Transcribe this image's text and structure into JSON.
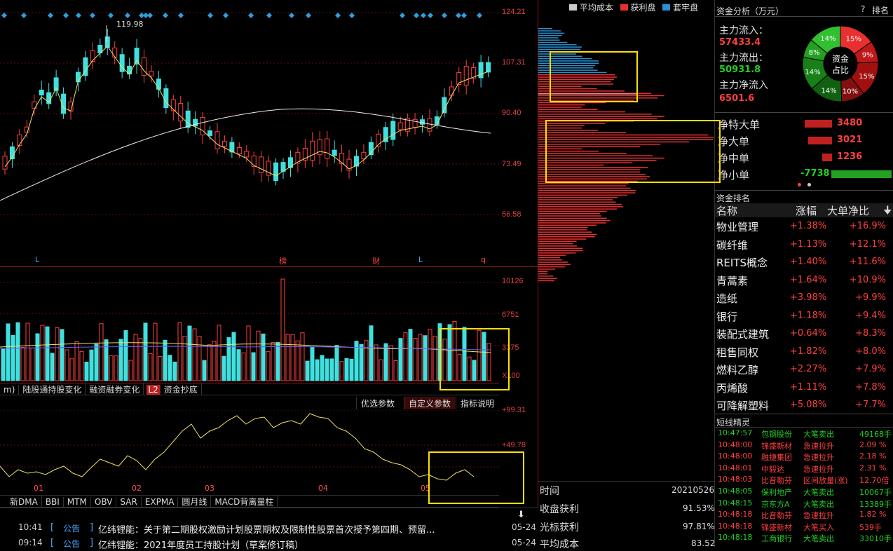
{
  "price_axis": [
    "124.21",
    "107.31",
    "90.40",
    "73.49",
    "56.58"
  ],
  "price_annotation": "119.98",
  "event_markers": [
    "L",
    "榜",
    "财",
    "L",
    "q"
  ],
  "volume_axis": [
    "10126",
    "6751",
    "3375",
    "X100"
  ],
  "indicator_tabs": [
    "m)",
    "陆股通持股变化",
    "融资融券变化",
    "L2",
    "资金抄底"
  ],
  "param_buttons": [
    "优选参数",
    "自定义参数",
    "指标说明"
  ],
  "osc_axis": [
    "+99.31",
    "+49.78"
  ],
  "month_labels": [
    "01",
    "02",
    "03",
    "04",
    "05"
  ],
  "bottom_tabs": [
    "新DMA",
    "BBI",
    "MTM",
    "OBV",
    "SAR",
    "EXPMA",
    "圆月线",
    "MACD背离量柱"
  ],
  "news": [
    {
      "time": "10:41",
      "tag": "公告",
      "text": "亿纬锂能：关于第二期股权激励计划股票期权及限制性股票首次授予第四期、预留...",
      "date": "05-24"
    },
    {
      "time": "09:14",
      "tag": "公告",
      "text": "亿纬锂能：2021年度员工持股计划（草案修订稿）",
      "date": "05-24"
    }
  ],
  "chip_legend": {
    "avg": "平均成本",
    "profit": "获利盘",
    "trapped": "套牢盘"
  },
  "chip_stats": {
    "time_label": "时间",
    "time_value": "20210526",
    "close_profit_label": "收盘获利",
    "close_profit_value": "91.53%",
    "cursor_profit_label": "光标获利",
    "cursor_profit_value": "97.81%",
    "avg_cost_label": "平均成本",
    "avg_cost_value": "83.52"
  },
  "fund": {
    "title": "资金分析（万元）",
    "help": "?",
    "rank_link": "排名",
    "inflow_label": "主力流入：",
    "inflow": "57433.4",
    "outflow_label": "主力流出：",
    "outflow": "50931.8",
    "net_label": "主力净流入",
    "net": "6501.6",
    "donut_center": [
      "资金",
      "占比"
    ],
    "donut": [
      {
        "label": "15%",
        "value": 15,
        "color": "#e83030"
      },
      {
        "label": "9%",
        "value": 9,
        "color": "#c01818"
      },
      {
        "label": "15%",
        "value": 15,
        "color": "#a01010"
      },
      {
        "label": "10%",
        "value": 10,
        "color": "#801010"
      },
      {
        "label": "14%",
        "value": 14,
        "color": "#106010"
      },
      {
        "label": "14%",
        "value": 14,
        "color": "#188018"
      },
      {
        "label": "8%",
        "value": 8,
        "color": "#22a022"
      },
      {
        "label": "14%",
        "value": 14,
        "color": "#30c030"
      }
    ],
    "orders": [
      {
        "label": "净特大单",
        "value": "3480",
        "amount": 3480,
        "color": "#c02020"
      },
      {
        "label": "净大单",
        "value": "3021",
        "amount": 3021,
        "color": "#c02020"
      },
      {
        "label": "净中单",
        "value": "1236",
        "amount": 1236,
        "color": "#c02020"
      },
      {
        "label": "净小单",
        "value": "-7738",
        "amount": -7738,
        "color": "#22a022"
      }
    ]
  },
  "rank": {
    "title": "资金排名",
    "headers": [
      "名称",
      "涨幅",
      "大单净比"
    ],
    "rows": [
      {
        "name": "物业管理",
        "change": "+1.38%",
        "ratio": "+16.9%"
      },
      {
        "name": "碳纤维",
        "change": "+1.13%",
        "ratio": "+12.1%"
      },
      {
        "name": "REITS概念",
        "change": "+1.40%",
        "ratio": "+11.6%"
      },
      {
        "name": "青蒿素",
        "change": "+1.64%",
        "ratio": "+10.9%"
      },
      {
        "name": "造纸",
        "change": "+3.98%",
        "ratio": "+9.9%"
      },
      {
        "name": "银行",
        "change": "+1.18%",
        "ratio": "+9.4%"
      },
      {
        "name": "装配式建筑",
        "change": "+0.64%",
        "ratio": "+8.3%"
      },
      {
        "name": "租售同权",
        "change": "+1.82%",
        "ratio": "+8.0%"
      },
      {
        "name": "燃料乙醇",
        "change": "+2.27%",
        "ratio": "+7.9%"
      },
      {
        "name": "丙烯酸",
        "change": "+1.11%",
        "ratio": "+7.8%"
      },
      {
        "name": "可降解塑料",
        "change": "+5.08%",
        "ratio": "+7.7%"
      }
    ]
  },
  "shortline": {
    "title": "短线精灵",
    "rows": [
      {
        "time": "10:47:57",
        "name": "包钢股份",
        "event": "大笔卖出",
        "value": "49168手",
        "color": "#22d022"
      },
      {
        "time": "10:48:00",
        "name": "锦盛新材",
        "event": "急速拉升",
        "value": "2.09 %",
        "color": "#ff4040"
      },
      {
        "time": "10:48:00",
        "name": "融捷集团",
        "event": "急速拉升",
        "value": "2.18 %",
        "color": "#ff4040"
      },
      {
        "time": "10:48:01",
        "name": "中毅达",
        "event": "急速拉升",
        "value": "2.31 %",
        "color": "#ff4040"
      },
      {
        "time": "10:48:03",
        "name": "比音勒芬",
        "event": "区间放量(涨)",
        "value": "12.70倍",
        "color": "#ff4040"
      },
      {
        "time": "10:48:05",
        "name": "保利地产",
        "event": "大笔卖出",
        "value": "10067手",
        "color": "#22d022"
      },
      {
        "time": "10:48:15",
        "name": "京东方A",
        "event": "大笔卖出",
        "value": "13389手",
        "color": "#22d022"
      },
      {
        "time": "10:48:18",
        "name": "比音勒芬",
        "event": "急速拉升",
        "value": "1.82 %",
        "color": "#ff4040"
      },
      {
        "time": "10:48:18",
        "name": "锦盛新材",
        "event": "大笔买入",
        "value": "539手",
        "color": "#ff4040"
      },
      {
        "time": "10:48:18",
        "name": "工商银行",
        "event": "大笔卖出",
        "value": "33010手",
        "color": "#22d022"
      }
    ]
  }
}
